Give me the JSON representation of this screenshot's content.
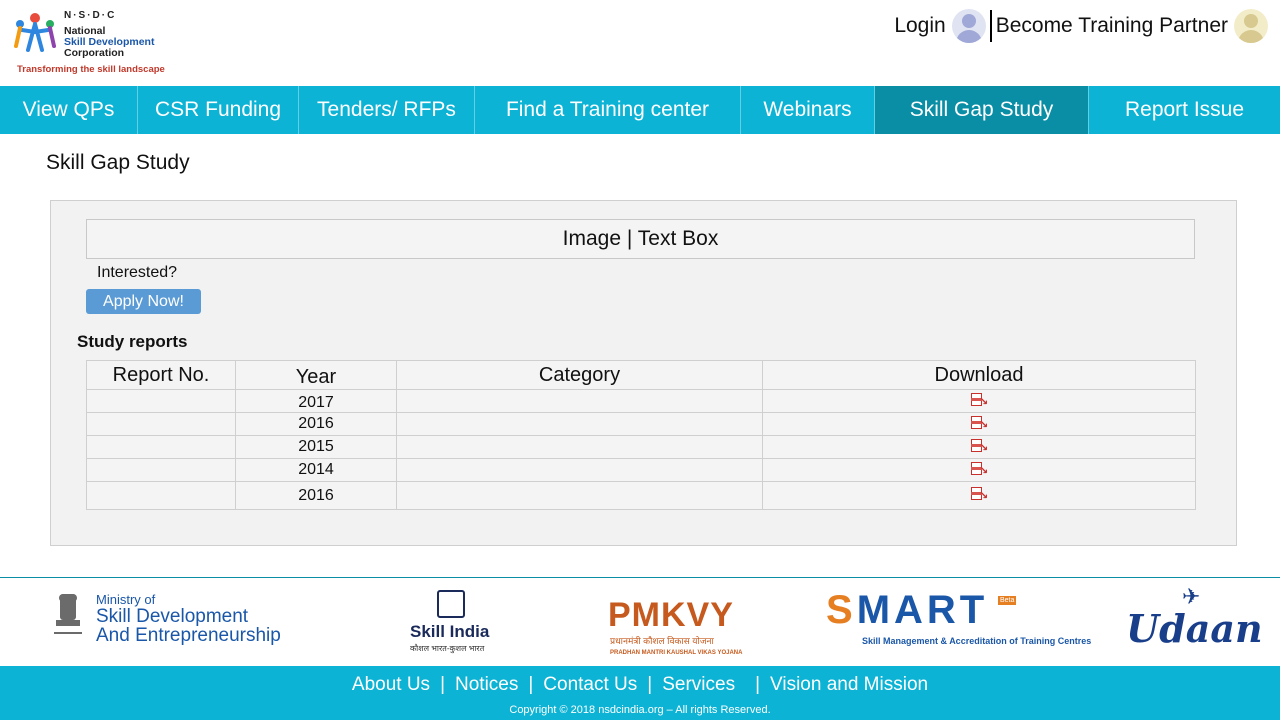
{
  "header": {
    "logo": {
      "abbr": "N·S·D·C",
      "line1": "National",
      "line2": "Skill Development",
      "line3": "Corporation",
      "tagline": "Transforming the skill landscape"
    },
    "login_label": "Login",
    "partner_label": "Become Training Partner"
  },
  "nav": {
    "items": [
      {
        "label": "View QPs"
      },
      {
        "label": "CSR Funding"
      },
      {
        "label": "Tenders/ RFPs"
      },
      {
        "label": "Find a Training center"
      },
      {
        "label": "Webinars"
      },
      {
        "label": "Skill Gap Study"
      },
      {
        "label": "Report Issue"
      }
    ],
    "active_index": 5
  },
  "page": {
    "title": "Skill Gap Study",
    "textbox_label": "Image | Text Box",
    "interested_label": "Interested?",
    "apply_label": "Apply Now!",
    "section_title": "Study reports"
  },
  "table": {
    "headers": {
      "report_no": "Report No.",
      "year": "Year",
      "category": "Category",
      "download": "Download"
    },
    "rows": [
      {
        "report_no": "",
        "year": "2017",
        "category": "",
        "download_icon": "pdf-download-icon"
      },
      {
        "report_no": "",
        "year": "2016",
        "category": "",
        "download_icon": "pdf-download-icon"
      },
      {
        "report_no": "",
        "year": "2015",
        "category": "",
        "download_icon": "pdf-download-icon"
      },
      {
        "report_no": "",
        "year": "2014",
        "category": "",
        "download_icon": "pdf-download-icon"
      },
      {
        "report_no": "",
        "year": "2016",
        "category": "",
        "download_icon": "pdf-download-icon"
      }
    ]
  },
  "partners": {
    "msde": {
      "line1": "Ministry of",
      "line2": "Skill Development",
      "line3": "And Entrepreneurship"
    },
    "skill_india": {
      "title": "Skill India",
      "subtitle": "कौशल भारत-कुशल भारत"
    },
    "pmkvy": {
      "title": "PMKVY",
      "subtitle": "प्रधानमंत्री कौशल विकास योजना",
      "subtitle2": "PRADHAN MANTRI KAUSHAL VIKAS YOJANA"
    },
    "smart": {
      "title": "SMART",
      "beta": "Beta",
      "subtitle": "Skill Management & Accreditation of Training Centres"
    },
    "udaan": {
      "title": "Udaan"
    }
  },
  "footer": {
    "links": [
      {
        "label": "About Us"
      },
      {
        "label": "Notices"
      },
      {
        "label": "Contact Us"
      },
      {
        "label": "Services"
      },
      {
        "label": "Vision and Mission"
      }
    ],
    "copyright": "Copyright © 2018 nsdcindia.org – All rights Reserved."
  },
  "colors": {
    "nav_bg": "#0db3d4",
    "nav_active": "#0a8ea6",
    "apply_button": "#5b9bd5",
    "panel_bg": "#f2f2f2"
  }
}
